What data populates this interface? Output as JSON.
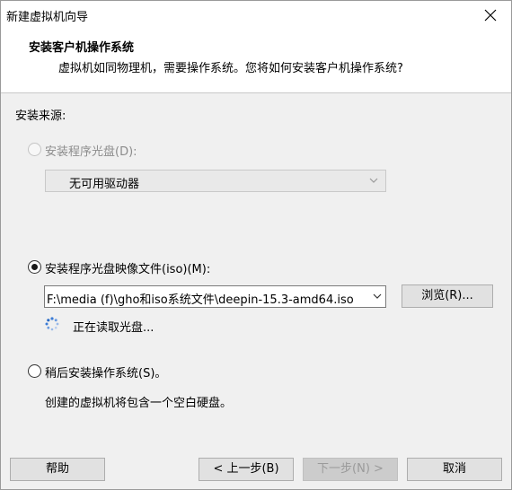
{
  "window": {
    "title": "新建虚拟机向导"
  },
  "header": {
    "title": "安装客户机操作系统",
    "subtitle": "虚拟机如同物理机，需要操作系统。您将如何安装客户机操作系统?"
  },
  "install_source": {
    "label": "安装来源:",
    "disc_option": {
      "label": "安装程序光盘(D):",
      "selected": false,
      "enabled": false,
      "drive_value": "无可用驱动器"
    },
    "iso_option": {
      "label": "安装程序光盘映像文件(iso)(M):",
      "selected": true,
      "path_value": "F:\\media (f)\\gho和iso系统文件\\deepin-15.3-amd64.iso",
      "browse_label": "浏览(R)...",
      "status_text": "正在读取光盘..."
    },
    "later_option": {
      "label": "稍后安装操作系统(S)。",
      "selected": false,
      "description": "创建的虚拟机将包含一个空白硬盘。"
    }
  },
  "footer": {
    "help_label": "帮助",
    "back_label": "< 上一步(B)",
    "next_label": "下一步(N) >",
    "cancel_label": "取消"
  }
}
